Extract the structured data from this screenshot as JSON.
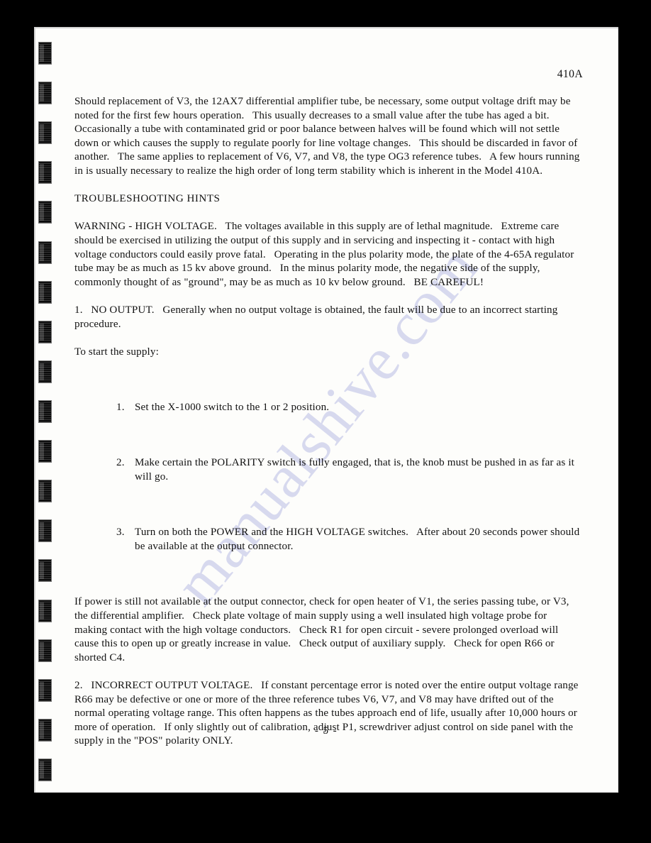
{
  "page": {
    "header_model": "410A",
    "page_number": "- 5 -",
    "watermark": "manualshive.com",
    "binding_mark_count": 19,
    "colors": {
      "page_background": "#fdfdfb",
      "surround": "#000000",
      "ink": "#121212",
      "watermark": "#b9bde4"
    }
  },
  "content": {
    "intro_paragraph": "Should replacement of V3, the 12AX7 differential amplifier tube, be necessary, some output voltage drift may be noted for the first few hours operation.   This usually decreases to a small value after the tube has aged a bit.   Occasionally a tube with contaminated grid or poor balance between halves will be found which will not settle down or which causes the supply to regulate poorly for line voltage changes.   This should be discarded in favor of another.   The same applies to replacement of V6, V7, and V8, the type OG3 reference tubes.   A few hours running in is usually necessary to realize the high order of long term stability which is inherent in the Model 410A.",
    "troubleshooting_heading": "TROUBLESHOOTING HINTS",
    "warning_paragraph": "WARNING - HIGH VOLTAGE.   The voltages available in this supply are of lethal magnitude.   Extreme care should be exercised in utilizing the output of this supply and in servicing and inspecting it - contact with high voltage conductors could easily prove fatal.   Operating in the plus polarity mode, the plate of the 4-65A regulator tube may be as much as 15 kv above ground.   In the minus polarity mode, the negative side of the supply, commonly thought of as \"ground\", may be as much as 10 kv below ground.   BE CAREFUL!",
    "item1_paragraph": "1.   NO OUTPUT.   Generally when no output voltage is obtained, the fault will be due to an incorrect starting procedure.",
    "start_supply_lead": "To start the supply:",
    "startup_steps": [
      {
        "number": "1.",
        "text": "Set the X-1000 switch to the 1 or 2 position."
      },
      {
        "number": "2.",
        "text": "Make certain the POLARITY switch is fully engaged, that is, the knob must be pushed in as far as it will go."
      },
      {
        "number": "3.",
        "text": "Turn on both the POWER and the HIGH VOLTAGE switches.   After about 20 seconds power should be available at the output connector."
      }
    ],
    "no_power_paragraph": "If power is still not available at the output connector, check for open heater of V1, the series passing tube, or V3, the differential amplifier.   Check plate voltage of main supply using a well insulated high voltage probe for making contact with the high voltage conductors.   Check R1 for open circuit - severe prolonged overload will cause this to open up or greatly increase in value.   Check output of auxiliary supply.   Check for open R66 or shorted C4.",
    "item2_paragraph": "2.   INCORRECT OUTPUT VOLTAGE.   If constant percentage error is noted over the entire output voltage range R66 may be defective or one or more of the three reference tubes V6, V7, and V8 may have drifted out of the normal operating voltage range. This often happens as the tubes approach end of life, usually after 10,000 hours or more of operation.   If only slightly out of calibration, adjust P1, screwdriver adjust control on side panel with the supply in the \"POS\" polarity ONLY."
  }
}
